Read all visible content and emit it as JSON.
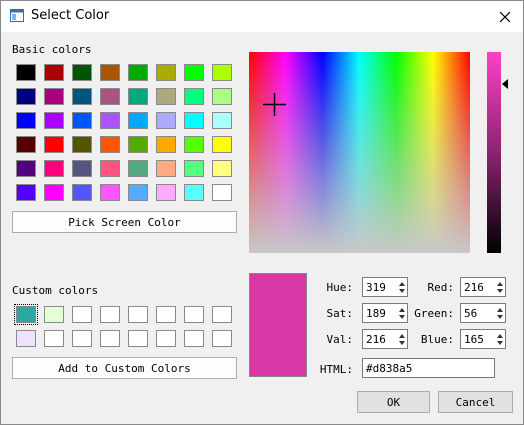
{
  "window": {
    "title": "Select Color"
  },
  "basic_colors": {
    "label": "Basic colors",
    "colors": [
      "#000000",
      "#aa0000",
      "#005500",
      "#aa5500",
      "#00aa00",
      "#aaaa00",
      "#00ff00",
      "#aaff00",
      "#00007f",
      "#aa007f",
      "#00557f",
      "#aa557f",
      "#00aa7f",
      "#aaaa7f",
      "#00ff7f",
      "#aaff7f",
      "#0000ff",
      "#aa00ff",
      "#0055ff",
      "#aa55ff",
      "#00aaff",
      "#aaaaff",
      "#00ffff",
      "#aaffff",
      "#550000",
      "#ff0000",
      "#555500",
      "#ff5500",
      "#55aa00",
      "#ffaa00",
      "#55ff00",
      "#ffff00",
      "#55007f",
      "#ff007f",
      "#55557f",
      "#ff557f",
      "#55aa7f",
      "#ffaa7f",
      "#55ff7f",
      "#ffff7f",
      "#5500ff",
      "#ff00ff",
      "#5555ff",
      "#ff55ff",
      "#55aaff",
      "#ffaaff",
      "#55ffff",
      "#ffffff"
    ]
  },
  "pick_screen_color": "Pick Screen Color",
  "custom_colors": {
    "label": "Custom colors",
    "colors": [
      "#2ba9a0",
      "#e2ffd6",
      "#ffffff",
      "#ffffff",
      "#ffffff",
      "#ffffff",
      "#ffffff",
      "#ffffff",
      "#efe2ff",
      "#ffffff",
      "#ffffff",
      "#ffffff",
      "#ffffff",
      "#ffffff",
      "#ffffff",
      "#ffffff"
    ]
  },
  "add_custom": "Add to Custom Colors",
  "current_color": "#d838a5",
  "fields": {
    "hue": {
      "label": "Hue:",
      "value": "319"
    },
    "sat": {
      "label": "Sat:",
      "value": "189"
    },
    "val": {
      "label": "Val:",
      "value": "216"
    },
    "red": {
      "label": "Red:",
      "value": "216"
    },
    "green": {
      "label": "Green:",
      "value": "56"
    },
    "blue": {
      "label": "Blue:",
      "value": "165"
    }
  },
  "html": {
    "label": "HTML:",
    "value": "#d838a5"
  },
  "buttons": {
    "ok": "OK",
    "cancel": "Cancel"
  }
}
